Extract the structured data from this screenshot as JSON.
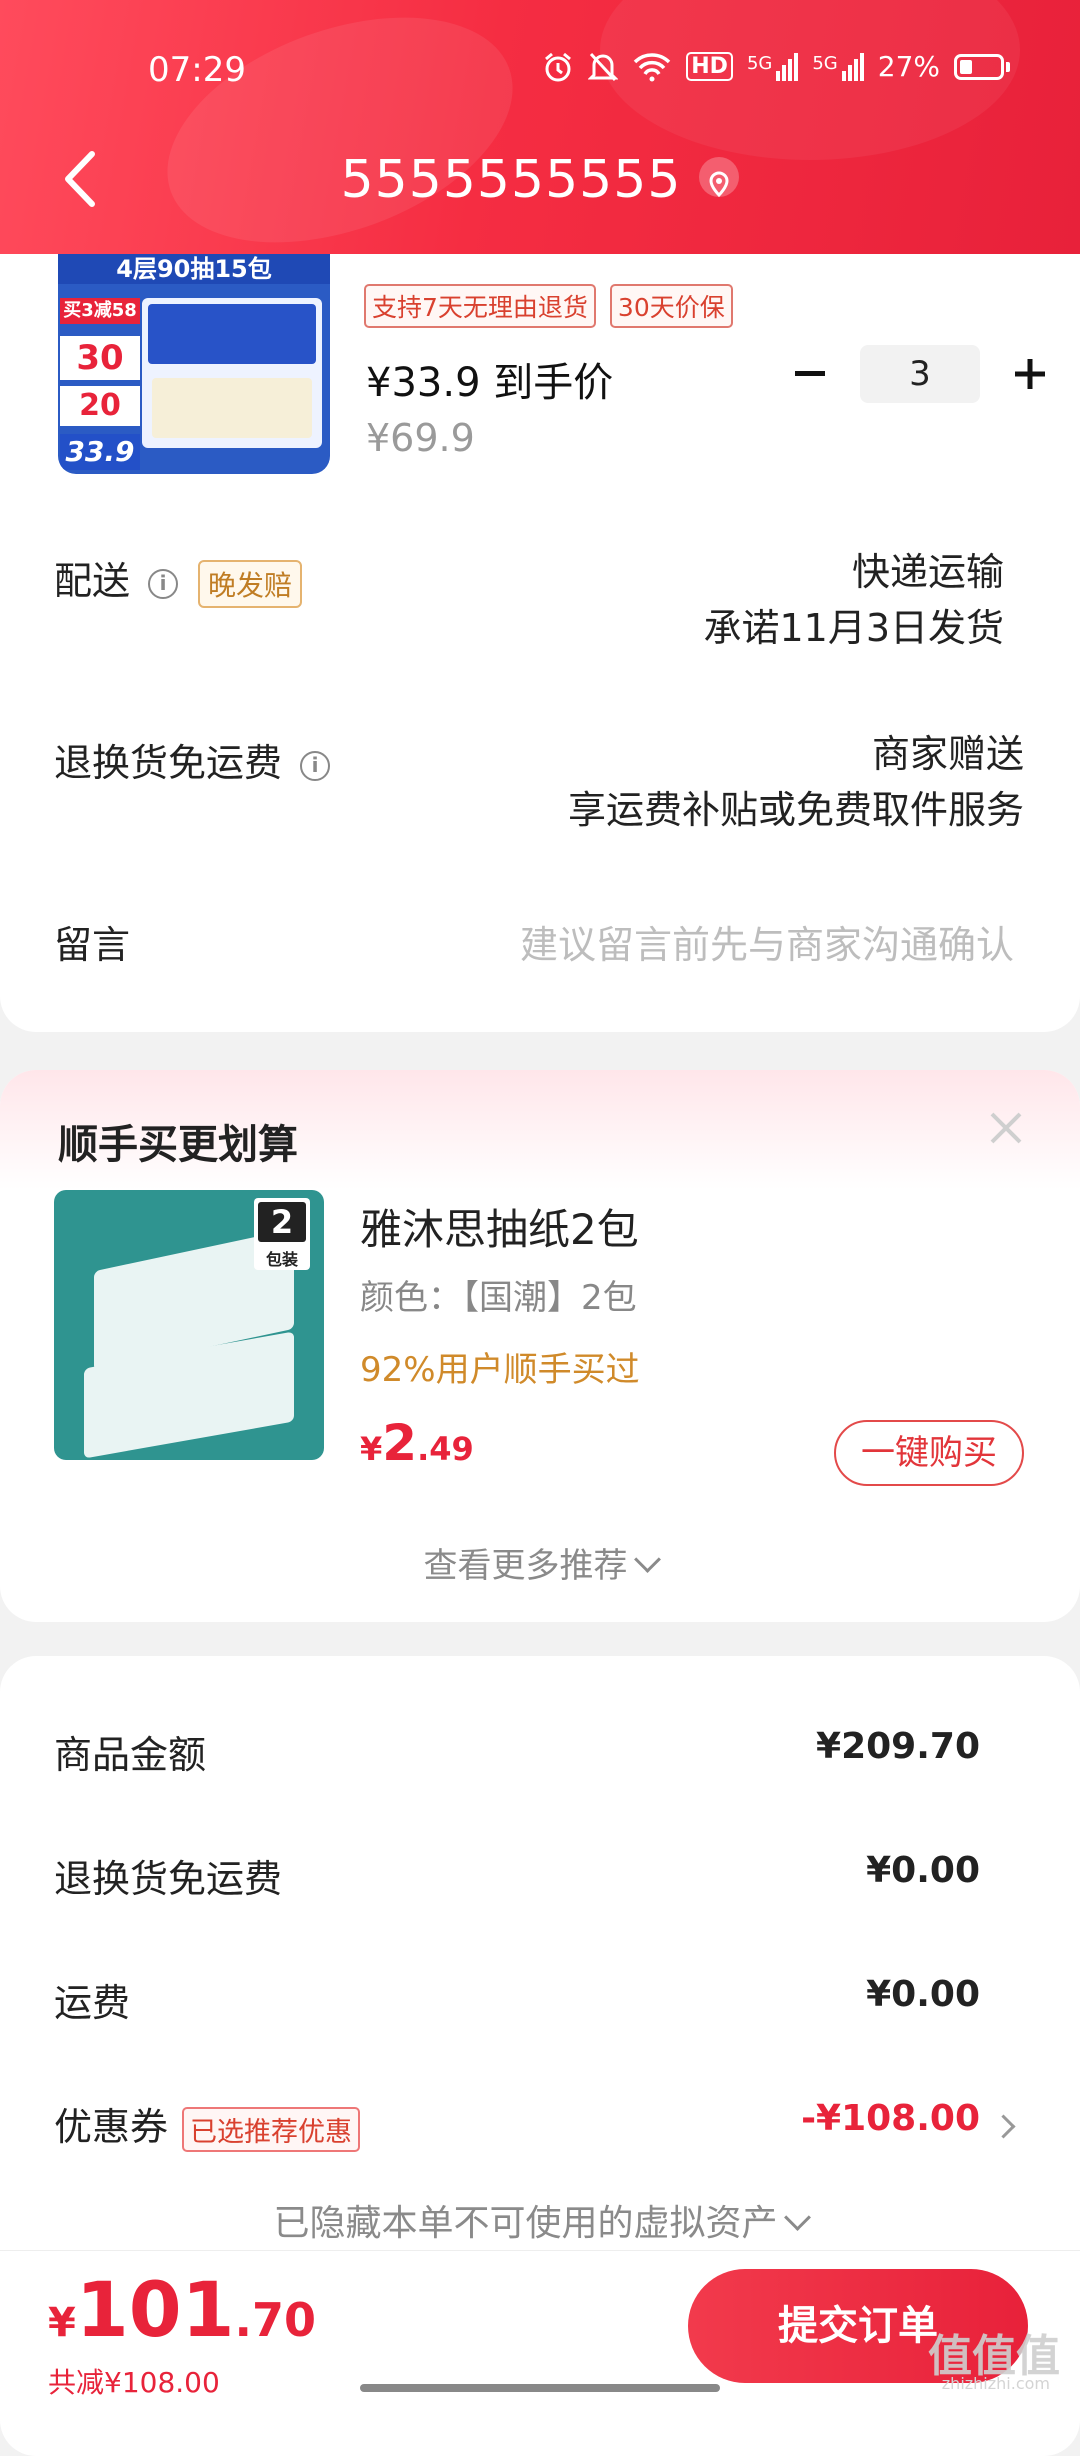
{
  "status_bar": {
    "time": "07:29",
    "battery": "27%",
    "icons": [
      "alarm-icon",
      "mute-bell-icon",
      "wifi-icon",
      "hd-icon",
      "5g-signal-icon",
      "5g-signal-icon",
      "battery-icon"
    ],
    "hd": "HD",
    "net1": "5G",
    "net2": "5G"
  },
  "header": {
    "title": "5555555555"
  },
  "product": {
    "tags": [
      "支持7天无理由退货",
      "30天价保"
    ],
    "price_label": "¥33.9 到手价",
    "original_price": "¥69.9",
    "quantity": "3",
    "image_text": {
      "top": "4层90抽15包",
      "promo1": "买3减58",
      "promo2": "30",
      "promo3": "20",
      "promo_price": "33.9"
    }
  },
  "delivery": {
    "label": "配送",
    "tag": "晚发赔",
    "method": "快递运输",
    "promise": "承诺11月3日发货"
  },
  "return_shipping": {
    "label": "退换货免运费",
    "line1": "商家赠送",
    "line2": "享运费补贴或免费取件服务"
  },
  "message": {
    "label": "留言",
    "placeholder": "建议留言前先与商家沟通确认"
  },
  "recommend": {
    "title": "顺手买更划算",
    "item_name": "雅沐思抽纸2包",
    "color": "颜色：【国潮】2包",
    "buyers": "92%用户顺手买过",
    "price_symbol": "¥",
    "price_int": "2",
    "price_dec": ".49",
    "buy_label": "一键购买",
    "more_label": "查看更多推荐",
    "image_badge": "2",
    "image_badge_sub": "包装"
  },
  "summary": {
    "items": [
      {
        "label": "商品金额",
        "value": "¥209.70"
      },
      {
        "label": "退换货免运费",
        "value": "¥0.00"
      },
      {
        "label": "运费",
        "value": "¥0.00"
      }
    ],
    "coupon_label": "优惠券",
    "coupon_tag": "已选推荐优惠",
    "coupon_value": "-¥108.00",
    "hidden_assets": "已隐藏本单不可使用的虚拟资产"
  },
  "bottom": {
    "total_symbol": "¥",
    "total_int": "101",
    "total_dec": ".70",
    "discount": "共减¥108.00",
    "submit_label": "提交订单"
  },
  "watermark": {
    "logo": "值值值",
    "site": "zhizhizhi.com"
  },
  "colors": {
    "header": "#f52d42",
    "accent": "#e8233a",
    "tag_orange": "#c07d24"
  }
}
